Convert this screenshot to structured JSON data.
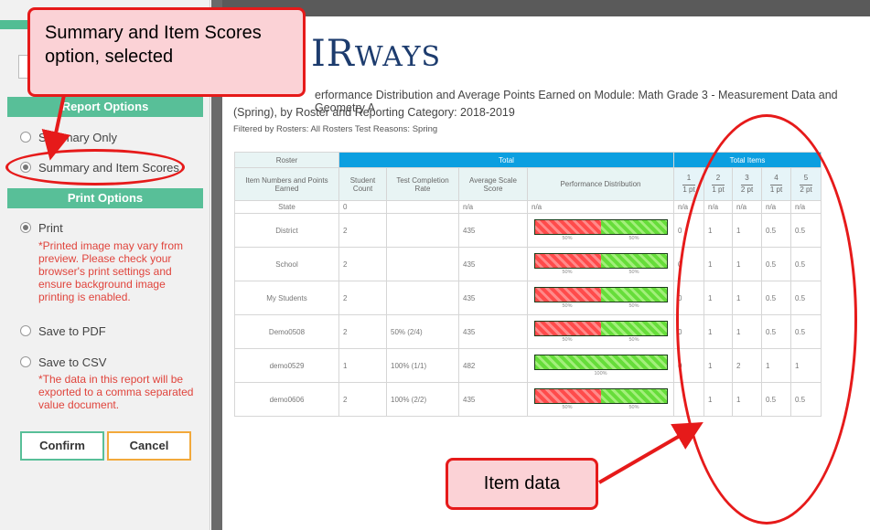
{
  "left_panel": {
    "report_options_header": "Report Options",
    "options": [
      {
        "label": "Summary Only",
        "selected": false
      },
      {
        "label": "Summary and Item Scores",
        "selected": true
      }
    ],
    "print_options_header": "Print Options",
    "print_label": "Print",
    "print_note": "*Printed image may vary from preview. Please check your browser's print settings and ensure background image printing is enabled.",
    "pdf_label": "Save to PDF",
    "csv_label": "Save to CSV",
    "csv_note": "*The data in this report will be exported to a comma separated value document.",
    "confirm_label": "Confirm",
    "cancel_label": "Cancel"
  },
  "report": {
    "logo_big": "IR",
    "logo_small": "WAYS",
    "title_line1": "erformance Distribution and Average Points Earned on Module: Math Grade 3 - Measurement Data and Geometry A",
    "title_line2": "(Spring), by Roster and Reporting Category: 2018-2019",
    "filter_line": "Filtered by Rosters: All Rosters Test Reasons: Spring",
    "table": {
      "group_headers": {
        "roster": "Roster",
        "total": "Total",
        "total_items": "Total Items"
      },
      "columns": [
        "Item Numbers and Points Earned",
        "Student Count",
        "Test Completion Rate",
        "Average Scale Score",
        "Performance Distribution"
      ],
      "items": [
        {
          "num": "1",
          "pt": "1 pt"
        },
        {
          "num": "2",
          "pt": "1 pt"
        },
        {
          "num": "3",
          "pt": "2 pt"
        },
        {
          "num": "4",
          "pt": "1 pt"
        },
        {
          "num": "5",
          "pt": "2 pt"
        }
      ],
      "state_row": {
        "name": "State",
        "count": "0",
        "rate": "",
        "score": "n/a",
        "dist": "n/a",
        "items": [
          "n/a",
          "n/a",
          "n/a",
          "n/a",
          "n/a"
        ]
      },
      "rows": [
        {
          "name": "District",
          "count": "2",
          "rate": "",
          "score": "435",
          "red": 50,
          "green": 50,
          "labels": [
            "50%",
            "50%"
          ],
          "items": [
            "0",
            "1",
            "1",
            "0.5",
            "0.5"
          ]
        },
        {
          "name": "School",
          "count": "2",
          "rate": "",
          "score": "435",
          "red": 50,
          "green": 50,
          "labels": [
            "50%",
            "50%"
          ],
          "items": [
            "0",
            "1",
            "1",
            "0.5",
            "0.5"
          ]
        },
        {
          "name": "My Students",
          "count": "2",
          "rate": "",
          "score": "435",
          "red": 50,
          "green": 50,
          "labels": [
            "50%",
            "50%"
          ],
          "items": [
            "0",
            "1",
            "1",
            "0.5",
            "0.5"
          ]
        },
        {
          "name": "Demo0508",
          "count": "2",
          "rate": "50% (2/4)",
          "score": "435",
          "red": 50,
          "green": 50,
          "labels": [
            "50%",
            "50%"
          ],
          "items": [
            "0",
            "1",
            "1",
            "0.5",
            "0.5"
          ]
        },
        {
          "name": "demo0529",
          "count": "1",
          "rate": "100% (1/1)",
          "score": "482",
          "red": 0,
          "green": 100,
          "labels": [
            "100%"
          ],
          "items": [
            "0",
            "1",
            "2",
            "1",
            "1"
          ]
        },
        {
          "name": "demo0606",
          "count": "2",
          "rate": "100% (2/2)",
          "score": "435",
          "red": 50,
          "green": 50,
          "labels": [
            "50%",
            "50%"
          ],
          "items": [
            "",
            "1",
            "1",
            "0.5",
            "0.5"
          ]
        }
      ]
    }
  },
  "callouts": {
    "summary": "Summary and Item Scores option, selected",
    "item_data": "Item data"
  },
  "colors": {
    "accent_green": "#58bf98",
    "header_blue": "#0c9fe0",
    "callout_red": "#e61a1a",
    "note_red": "#e0443c"
  }
}
